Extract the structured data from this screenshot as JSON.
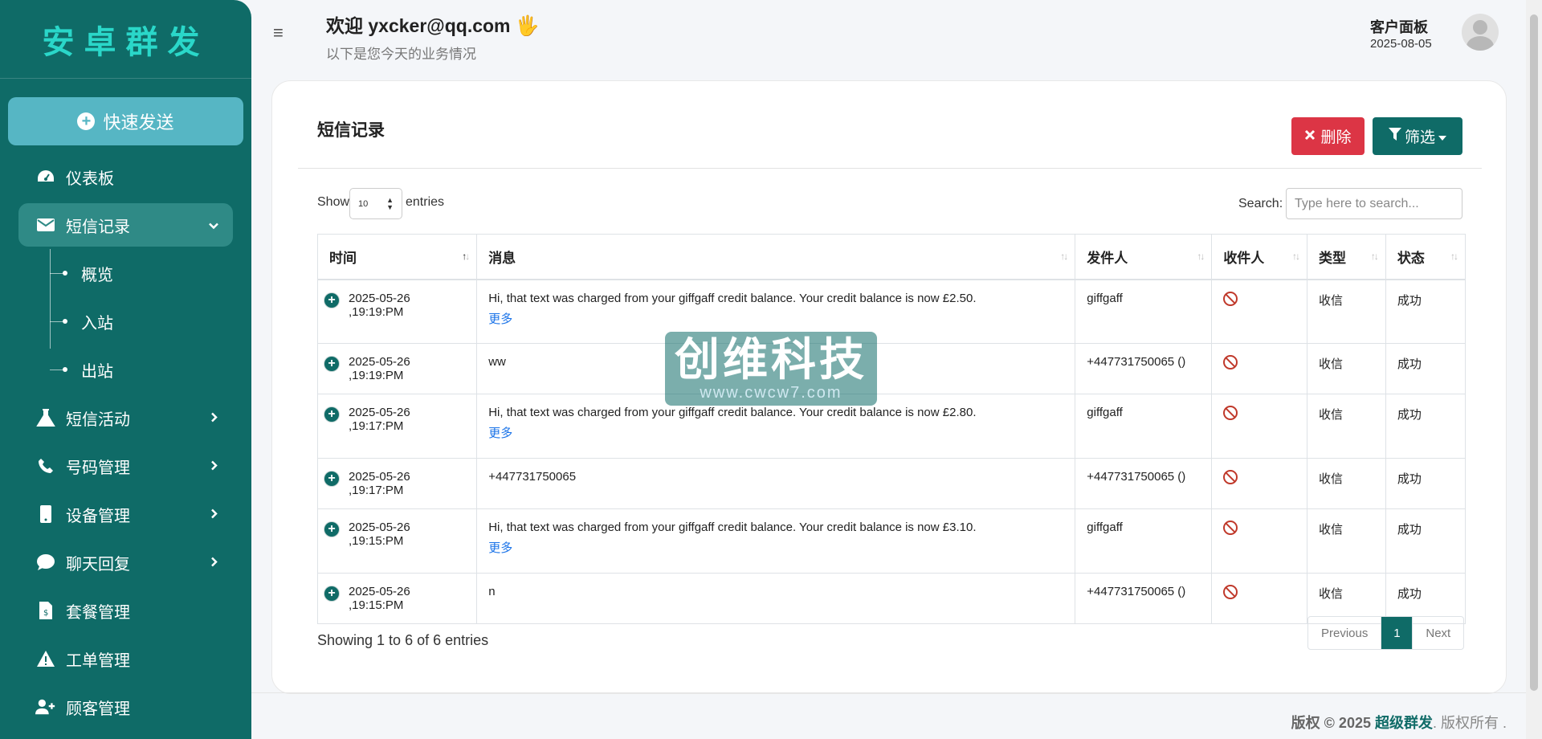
{
  "sidebar": {
    "brand": "安卓群发",
    "quick_send": "快速发送",
    "items": [
      {
        "label": "仪表板",
        "icon": "dashboard-icon"
      },
      {
        "label": "短信记录",
        "icon": "envelope-icon"
      },
      {
        "label": "短信活动",
        "icon": "flask-icon"
      },
      {
        "label": "号码管理",
        "icon": "phone-icon"
      },
      {
        "label": "设备管理",
        "icon": "mobile-icon"
      },
      {
        "label": "聊天回复",
        "icon": "sms-chat-icon"
      },
      {
        "label": "套餐管理",
        "icon": "invoice-icon"
      },
      {
        "label": "工单管理",
        "icon": "warning-icon"
      },
      {
        "label": "顾客管理",
        "icon": "user-plus-icon"
      }
    ],
    "sub_items": [
      "概览",
      "入站",
      "出站"
    ]
  },
  "header": {
    "welcome": "欢迎 yxcker@qq.com",
    "subtitle": "以下是您今天的业务情况",
    "panel_title": "客户面板",
    "panel_date": "2025-08-05"
  },
  "card": {
    "title": "短信记录",
    "delete_label": "删除",
    "filter_label": "筛选",
    "show_label": "Show",
    "show_value": "10",
    "entries_label": "entries",
    "search_label": "Search:",
    "search_placeholder": "Type here to search...",
    "columns": [
      "时间",
      "消息",
      "发件人",
      "收件人",
      "类型",
      "状态"
    ],
    "more_label": "更多",
    "rows": [
      {
        "time": "2025-05-26 ,19:19:PM",
        "message": "Hi, that text was charged from your giffgaff credit balance. Your credit balance is now £2.50.",
        "more": true,
        "sender": "giffgaff",
        "type": "收信",
        "status": "成功"
      },
      {
        "time": "2025-05-26 ,19:19:PM",
        "message": "ww",
        "more": false,
        "sender": "+447731750065 ()",
        "type": "收信",
        "status": "成功"
      },
      {
        "time": "2025-05-26 ,19:17:PM",
        "message": "Hi, that text was charged from your giffgaff credit balance. Your credit balance is now £2.80.",
        "more": true,
        "sender": "giffgaff",
        "type": "收信",
        "status": "成功"
      },
      {
        "time": "2025-05-26 ,19:17:PM",
        "message": "+447731750065",
        "more": false,
        "sender": "+447731750065 ()",
        "type": "收信",
        "status": "成功"
      },
      {
        "time": "2025-05-26 ,19:15:PM",
        "message": "Hi, that text was charged from your giffgaff credit balance. Your credit balance is now £3.10.",
        "more": true,
        "sender": "giffgaff",
        "type": "收信",
        "status": "成功"
      },
      {
        "time": "2025-05-26 ,19:15:PM",
        "message": "n",
        "more": false,
        "sender": "+447731750065 ()",
        "type": "收信",
        "status": "成功"
      }
    ],
    "showing": "Showing 1 to 6 of 6 entries",
    "pager": {
      "prev": "Previous",
      "current": "1",
      "next": "Next"
    }
  },
  "watermark": {
    "main": "创维科技",
    "sub": "www.cwcw7.com"
  },
  "footer": {
    "prefix": "版权 © 2025 ",
    "brand": "超级群发",
    "suffix": ". 版权所有 ."
  },
  "colors": {
    "primary": "#0f6b67",
    "accent": "#2ad7c9",
    "danger": "#dc3545",
    "quick_send": "#56b6c4"
  }
}
